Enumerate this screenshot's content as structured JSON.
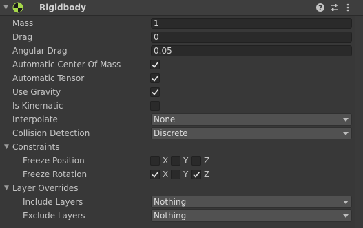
{
  "header": {
    "title": "Rigidbody",
    "icons": [
      "help-icon",
      "preset-icon",
      "kebab-menu-icon"
    ]
  },
  "fields": {
    "mass": {
      "label": "Mass",
      "value": "1"
    },
    "drag": {
      "label": "Drag",
      "value": "0"
    },
    "angular_drag": {
      "label": "Angular Drag",
      "value": "0.05"
    },
    "auto_com": {
      "label": "Automatic Center Of Mass",
      "checked": true
    },
    "auto_tensor": {
      "label": "Automatic Tensor",
      "checked": true
    },
    "use_gravity": {
      "label": "Use Gravity",
      "checked": true
    },
    "is_kinematic": {
      "label": "Is Kinematic",
      "checked": false
    },
    "interpolate": {
      "label": "Interpolate",
      "value": "None"
    },
    "collision_detection": {
      "label": "Collision Detection",
      "value": "Discrete"
    }
  },
  "constraints": {
    "label": "Constraints",
    "freeze_position": {
      "label": "Freeze Position",
      "x": false,
      "y": false,
      "z": false
    },
    "freeze_rotation": {
      "label": "Freeze Rotation",
      "x": true,
      "y": false,
      "z": true
    },
    "axes": {
      "x": "X",
      "y": "Y",
      "z": "Z"
    }
  },
  "layer_overrides": {
    "label": "Layer Overrides",
    "include": {
      "label": "Include Layers",
      "value": "Nothing"
    },
    "exclude": {
      "label": "Exclude Layers",
      "value": "Nothing"
    }
  }
}
